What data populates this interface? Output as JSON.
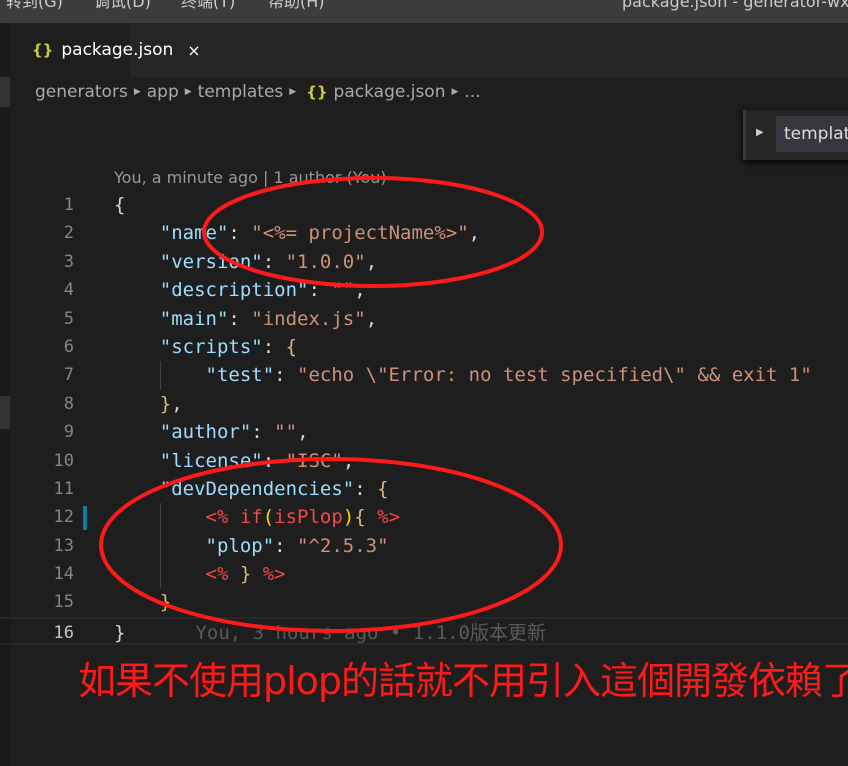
{
  "menubar": {
    "items": [
      "转到(G)",
      "调试(D)",
      "终端(T)",
      "帮助(H)"
    ],
    "window_title": "package.json - generator-wx"
  },
  "tab": {
    "icon": "json-braces-icon",
    "label": "package.json",
    "close": "×"
  },
  "breadcrumb": [
    "generators",
    "app",
    "templates",
    "package.json",
    "..."
  ],
  "outline": {
    "item": "templat"
  },
  "codelens": "You, a minute ago | 1 author (You)",
  "code": [
    [
      [
        "p",
        "{"
      ]
    ],
    [
      [
        "p",
        "    "
      ],
      [
        "k",
        "\"name\""
      ],
      [
        "p",
        ": "
      ],
      [
        "s",
        "\"<%= projectName%>\""
      ],
      [
        "p",
        ","
      ]
    ],
    [
      [
        "p",
        "    "
      ],
      [
        "k",
        "\"version\""
      ],
      [
        "p",
        ": "
      ],
      [
        "s",
        "\"1.0.0\""
      ],
      [
        "p",
        ","
      ]
    ],
    [
      [
        "p",
        "    "
      ],
      [
        "k",
        "\"description\""
      ],
      [
        "p",
        ": "
      ],
      [
        "s",
        "\"\""
      ],
      [
        "p",
        ","
      ]
    ],
    [
      [
        "p",
        "    "
      ],
      [
        "k",
        "\"main\""
      ],
      [
        "p",
        ": "
      ],
      [
        "s",
        "\"index.js\""
      ],
      [
        "p",
        ","
      ]
    ],
    [
      [
        "p",
        "    "
      ],
      [
        "k",
        "\"scripts\""
      ],
      [
        "p",
        ": "
      ],
      [
        "b",
        "{"
      ]
    ],
    [
      [
        "p",
        "        "
      ],
      [
        "k",
        "\"test\""
      ],
      [
        "p",
        ": "
      ],
      [
        "s",
        "\"echo \\\"Error: no test specified\\\" && exit 1\""
      ]
    ],
    [
      [
        "p",
        "    "
      ],
      [
        "b",
        "}"
      ],
      [
        "p",
        ","
      ]
    ],
    [
      [
        "p",
        "    "
      ],
      [
        "k",
        "\"author\""
      ],
      [
        "p",
        ": "
      ],
      [
        "s",
        "\"\""
      ],
      [
        "p",
        ","
      ]
    ],
    [
      [
        "p",
        "    "
      ],
      [
        "k",
        "\"license\""
      ],
      [
        "p",
        ": "
      ],
      [
        "s",
        "\"ISC\""
      ],
      [
        "p",
        ","
      ]
    ],
    [
      [
        "p",
        "    "
      ],
      [
        "k",
        "\"devDependencies\""
      ],
      [
        "p",
        ": "
      ],
      [
        "b",
        "{"
      ]
    ],
    [
      [
        "p",
        "        "
      ],
      [
        "e",
        "<% if"
      ],
      [
        "y",
        "("
      ],
      [
        "e",
        "isPlop"
      ],
      [
        "y",
        ")"
      ],
      [
        "b",
        "{"
      ],
      [
        "e",
        " %>"
      ]
    ],
    [
      [
        "p",
        "        "
      ],
      [
        "k",
        "\"plop\""
      ],
      [
        "p",
        ": "
      ],
      [
        "s",
        "\"^2.5.3\""
      ]
    ],
    [
      [
        "p",
        "        "
      ],
      [
        "e",
        "<% "
      ],
      [
        "b",
        "}"
      ],
      [
        "e",
        " %>"
      ]
    ],
    [
      [
        "p",
        "    "
      ],
      [
        "b",
        "}"
      ]
    ],
    [
      [
        "p",
        "}"
      ]
    ]
  ],
  "blame_line16": "You, 3 hours ago • 1.1.0版本更新",
  "annotation": "如果不使用plop的話就不用引入這個開發依賴了",
  "colors": {
    "annotation": "#ff1a1a",
    "key": "#9cdcfe",
    "string": "#ce9178",
    "ejs": "#f44747"
  }
}
